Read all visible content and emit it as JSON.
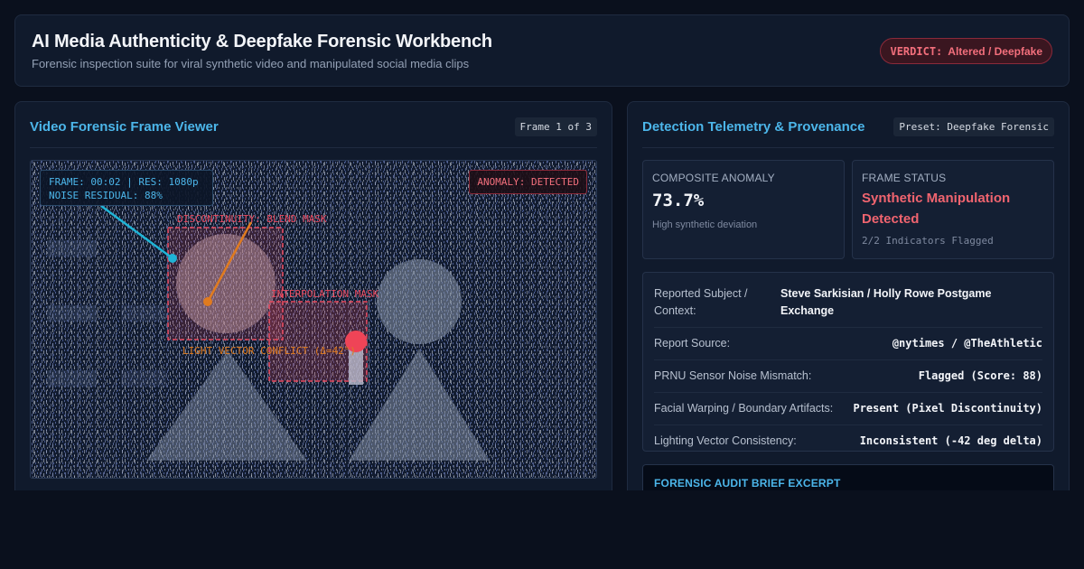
{
  "header": {
    "title": "AI Media Authenticity & Deepfake Forensic Workbench",
    "subtitle": "Forensic inspection suite for viral synthetic video and manipulated social media clips",
    "verdict_label": "VERDICT:",
    "verdict_value": "Altered / Deepfake"
  },
  "viewer_panel": {
    "title": "Video Forensic Frame Viewer",
    "frame_indicator": "Frame 1 of 3",
    "hud_line1": "FRAME: 00:02 | RES: 1080p",
    "hud_line2": "NOISE RESIDUAL: 88%",
    "anomaly_badge": "ANOMALY: DETECTED",
    "overlay_discontinuity": "DISCONTINUITY: BLEND MASK",
    "overlay_interpolation": "INTERPOLATION MASK",
    "overlay_lighting": "LIGHT VECTOR CONFLICT (Δ=42°)"
  },
  "telemetry_panel": {
    "title": "Detection Telemetry & Provenance",
    "preset": "Preset: Deepfake Forensic",
    "composite": {
      "label": "COMPOSITE ANOMALY",
      "value": "73.7%",
      "note": "High synthetic deviation"
    },
    "frame_status": {
      "label": "FRAME STATUS",
      "value": "Synthetic Manipulation Detected",
      "note": "2/2 Indicators Flagged"
    },
    "details": [
      {
        "key": "Reported Subject / Context:",
        "value": "Steve Sarkisian / Holly Rowe Postgame Exchange"
      },
      {
        "key": "Report Source:",
        "value": "@nytimes / @TheAthletic"
      },
      {
        "key": "PRNU Sensor Noise Mismatch:",
        "value": "Flagged (Score: 88)"
      },
      {
        "key": "Facial Warping / Boundary Artifacts:",
        "value": "Present (Pixel Discontinuity)"
      },
      {
        "key": "Lighting Vector Consistency:",
        "value": "Inconsistent (-42 deg delta)"
      }
    ],
    "brief_title": "FORENSIC AUDIT BRIEF EXCERPT"
  },
  "colors": {
    "accent": "#4cb6ea",
    "alert": "#f0646f",
    "warning": "#e07b1f",
    "background": "#0a101d",
    "panel": "#101a2c"
  }
}
